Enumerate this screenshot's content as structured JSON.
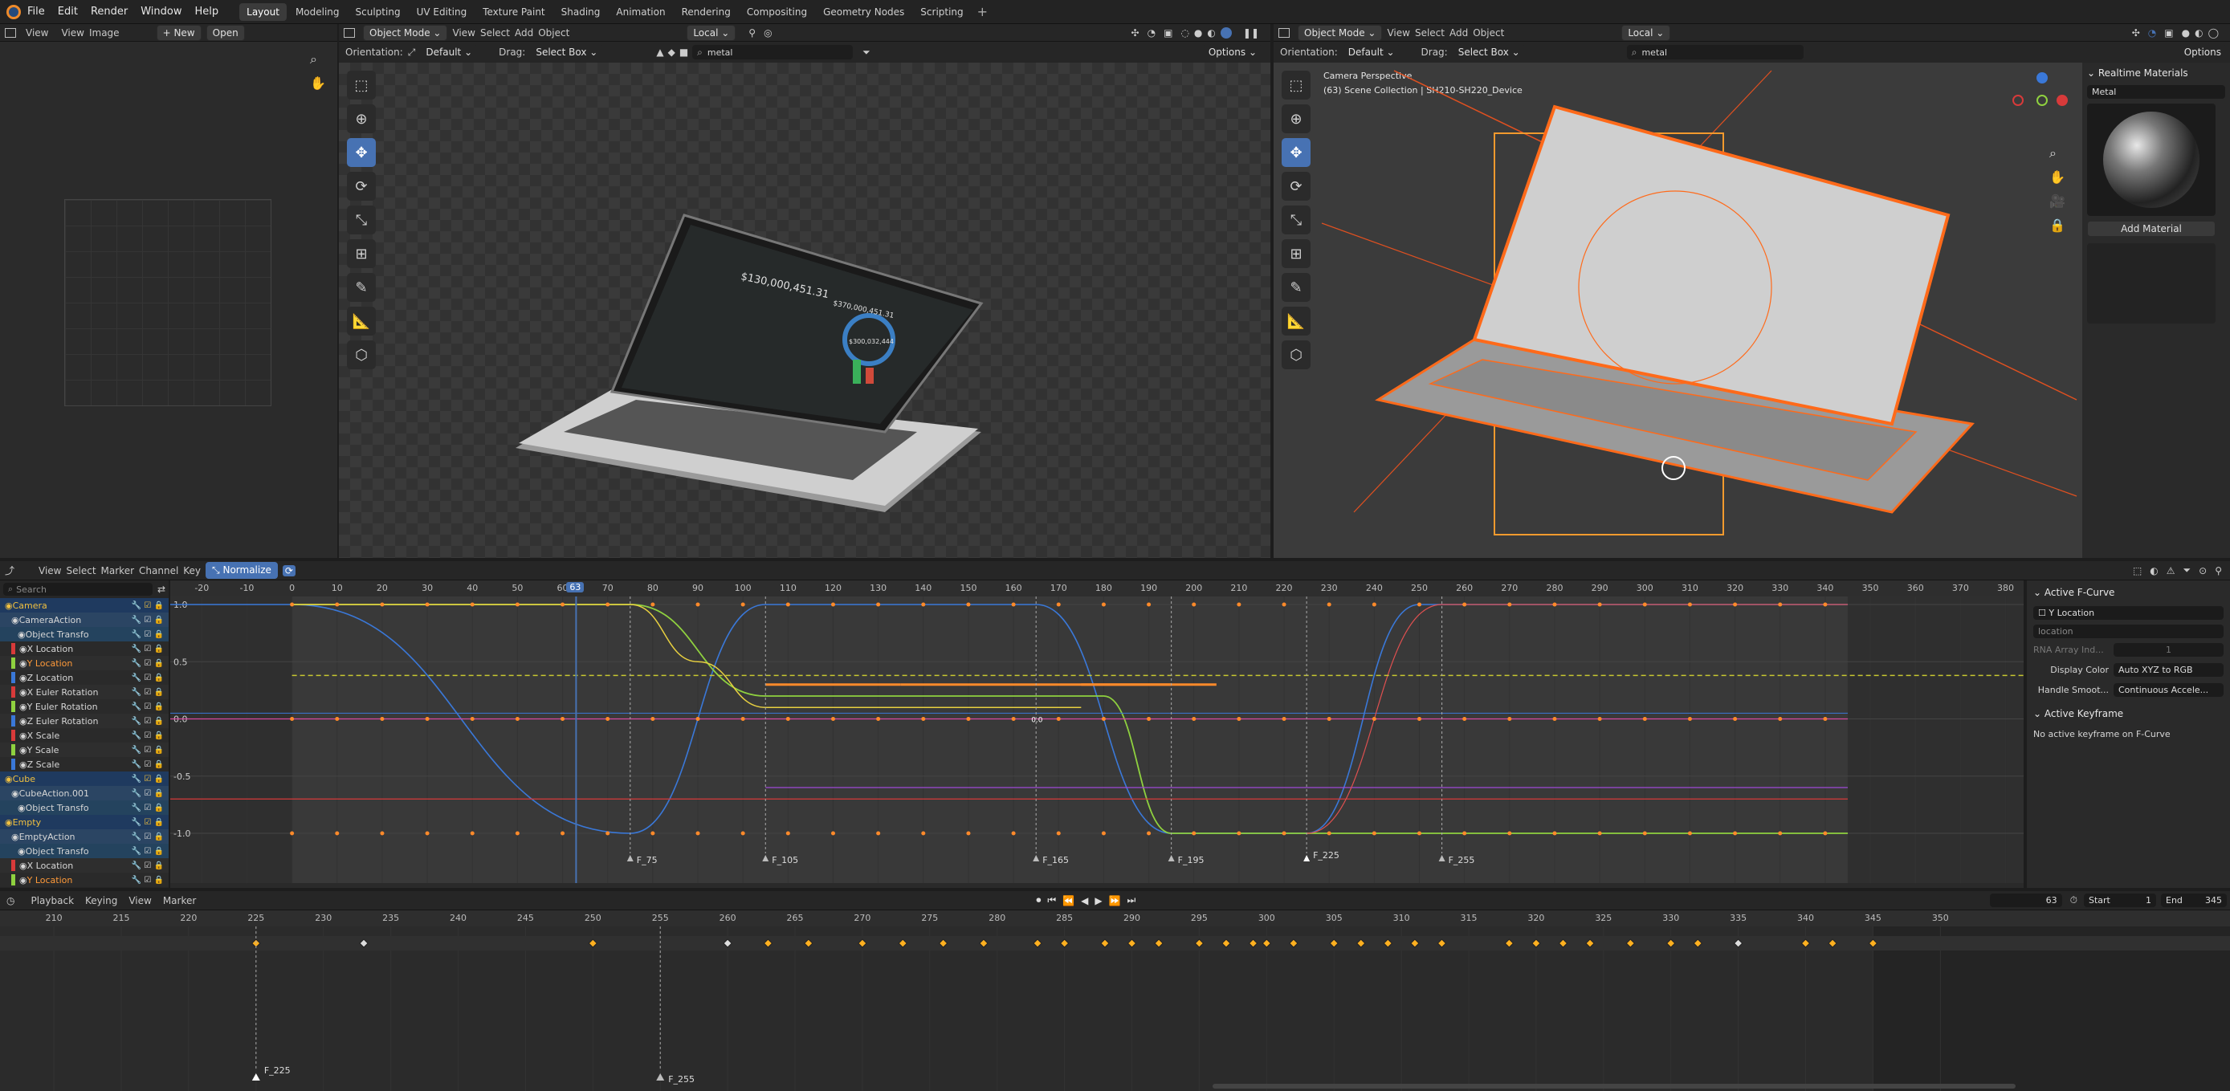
{
  "top_menu": [
    "File",
    "Edit",
    "Render",
    "Window",
    "Help"
  ],
  "workspaces": [
    "Layout",
    "Modeling",
    "Sculpting",
    "UV Editing",
    "Texture Paint",
    "Shading",
    "Animation",
    "Rendering",
    "Compositing",
    "Geometry Nodes",
    "Scripting"
  ],
  "active_workspace": "Layout",
  "image_editor": {
    "menus": [
      "View",
      "View",
      "Image"
    ],
    "new_label": "New",
    "open_label": "Open"
  },
  "viewport_left": {
    "mode": "Object Mode",
    "menus": [
      "View",
      "Select",
      "Add",
      "Object"
    ],
    "transform": "Local",
    "orientation_label": "Orientation:",
    "orientation": "Default",
    "drag_label": "Drag:",
    "drag": "Select Box",
    "search": "metal",
    "options": "Options"
  },
  "laptop_screen": {
    "amount1": "$130,000,451.31",
    "amount2": "$370,000,451.31",
    "donut_value": "$300,032,444"
  },
  "viewport_right": {
    "mode": "Object Mode",
    "menus": [
      "View",
      "Select",
      "Add",
      "Object"
    ],
    "transform": "Local",
    "orientation_label": "Orientation:",
    "orientation": "Default",
    "drag_label": "Drag:",
    "drag": "Select Box",
    "search": "metal",
    "options": "Options",
    "overlay_line1": "Camera Perspective",
    "overlay_line2": "(63) Scene Collection | SH210-SH220_Device"
  },
  "material_panel": {
    "title": "Realtime Materials",
    "material": "Metal",
    "add_button": "Add Material"
  },
  "graph_editor": {
    "menus": [
      "View",
      "Select",
      "Marker",
      "Channel",
      "Key"
    ],
    "normalize": "Normalize",
    "search_placeholder": "Search",
    "current_frame": "63",
    "ruler": [
      "-20",
      "-10",
      "0",
      "10",
      "20",
      "30",
      "40",
      "50",
      "60",
      "70",
      "80",
      "90",
      "100",
      "110",
      "120",
      "130",
      "140",
      "150",
      "160",
      "170",
      "180",
      "190",
      "200",
      "210",
      "220",
      "230",
      "240",
      "250",
      "260",
      "270",
      "280",
      "290",
      "300",
      "310",
      "320",
      "330",
      "340",
      "350",
      "360",
      "370",
      "380"
    ],
    "y_labels": [
      "1.0",
      "0.5",
      "0.0",
      "-0.5",
      "-1.0"
    ],
    "markers": [
      "F_75",
      "F_105",
      "F_165",
      "F_195",
      "F_225",
      "F_255"
    ],
    "keyframe_label": "0.0",
    "channels": [
      {
        "label": "Camera",
        "kind": "obj",
        "color": ""
      },
      {
        "label": "CameraAction",
        "kind": "grp",
        "color": ""
      },
      {
        "label": "Object Transfo",
        "kind": "grp2",
        "color": ""
      },
      {
        "label": "X Location",
        "kind": "ch",
        "color": "#d83a3a"
      },
      {
        "label": "Y Location",
        "kind": "ch-sel",
        "color": "#8fd13f"
      },
      {
        "label": "Z Location",
        "kind": "ch",
        "color": "#3a78d8"
      },
      {
        "label": "X Euler Rotation",
        "kind": "ch",
        "color": "#d83a3a"
      },
      {
        "label": "Y Euler Rotation",
        "kind": "ch",
        "color": "#8fd13f"
      },
      {
        "label": "Z Euler Rotation",
        "kind": "ch",
        "color": "#3a78d8"
      },
      {
        "label": "X Scale",
        "kind": "ch",
        "color": "#d83a3a"
      },
      {
        "label": "Y Scale",
        "kind": "ch",
        "color": "#8fd13f"
      },
      {
        "label": "Z Scale",
        "kind": "ch",
        "color": "#3a78d8"
      },
      {
        "label": "Cube",
        "kind": "obj",
        "color": ""
      },
      {
        "label": "CubeAction.001",
        "kind": "grp",
        "color": ""
      },
      {
        "label": "Object Transfo",
        "kind": "grp2",
        "color": ""
      },
      {
        "label": "Empty",
        "kind": "obj",
        "color": ""
      },
      {
        "label": "EmptyAction",
        "kind": "grp",
        "color": ""
      },
      {
        "label": "Object Transfo",
        "kind": "grp2",
        "color": ""
      },
      {
        "label": "X Location",
        "kind": "ch",
        "color": "#d83a3a"
      },
      {
        "label": "Y Location",
        "kind": "ch-sel",
        "color": "#8fd13f"
      }
    ]
  },
  "fcurve_sidebar": {
    "active_fcurve_title": "Active F-Curve",
    "fcurve_name": "Y Location",
    "data_path": "location",
    "rna_label": "RNA Array Ind...",
    "rna_value": "1",
    "display_color_label": "Display Color",
    "display_color": "Auto XYZ to RGB",
    "handle_label": "Handle Smoot...",
    "handle_value": "Continuous Accele...",
    "active_keyframe_title": "Active Keyframe",
    "no_keyframe": "No active keyframe on F-Curve"
  },
  "timeline": {
    "menus": [
      "Playback",
      "Keying",
      "View",
      "Marker"
    ],
    "frame": "63",
    "start_label": "Start",
    "start": "1",
    "end_label": "End",
    "end": "345",
    "ruler": [
      "210",
      "215",
      "220",
      "225",
      "230",
      "235",
      "240",
      "245",
      "250",
      "255",
      "260",
      "265",
      "270",
      "275",
      "280",
      "285",
      "290",
      "295",
      "300",
      "305",
      "310",
      "315",
      "320",
      "325",
      "330",
      "335",
      "340",
      "345",
      "350"
    ],
    "markers": [
      "F_225",
      "F_255"
    ]
  },
  "colors": {
    "accent": "#4772b3",
    "selected": "#ff7a1a",
    "x_axis": "#d83a3a",
    "y_axis": "#8fd13f",
    "z_axis": "#3a78d8"
  }
}
